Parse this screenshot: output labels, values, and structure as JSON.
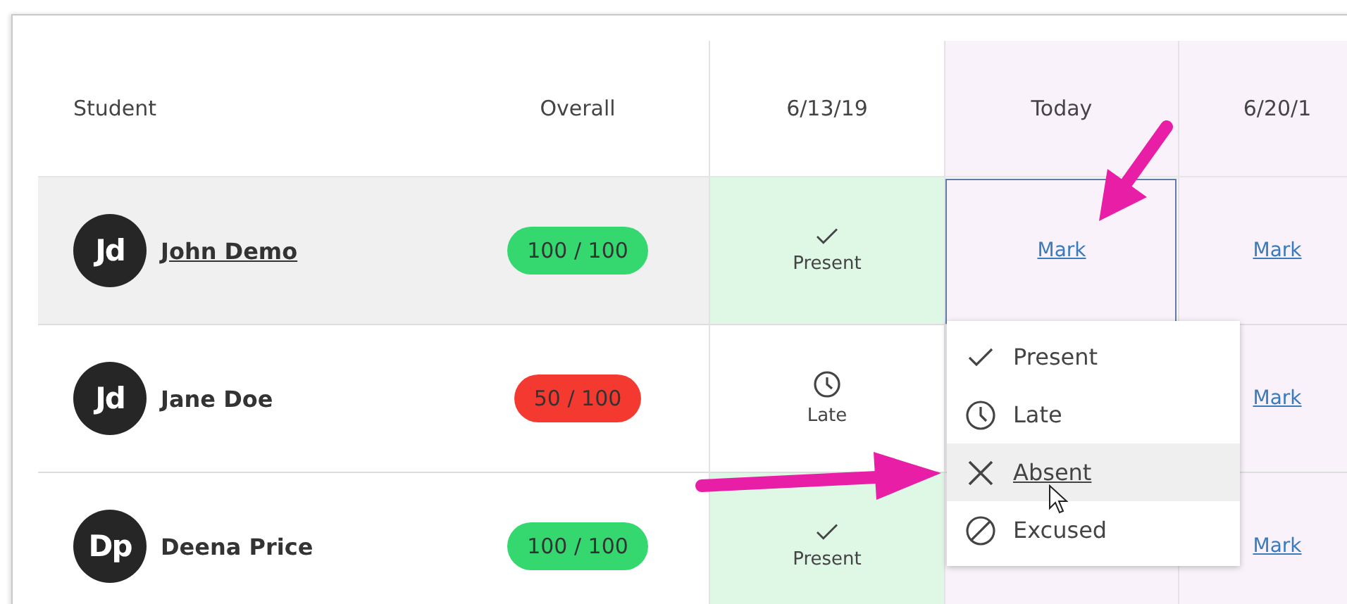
{
  "columns": [
    {
      "label": "Student",
      "today": false
    },
    {
      "label": "Overall",
      "today": false
    },
    {
      "label": "6/13/19",
      "today": false
    },
    {
      "label": "Today",
      "today": true
    },
    {
      "label": "6/20/1",
      "today": true
    }
  ],
  "rows": [
    {
      "initials": "Jd",
      "name": "John Demo",
      "link": true,
      "selected": true,
      "score": "100 / 100",
      "color": "#34d86e",
      "cells": [
        {
          "kind": "present",
          "label": "Present"
        },
        {
          "kind": "mark",
          "label": "Mark",
          "focused": true
        },
        {
          "kind": "mark",
          "label": "Mark",
          "focused": false
        }
      ]
    },
    {
      "initials": "Jd",
      "name": "Jane Doe",
      "link": false,
      "selected": false,
      "score": "50 / 100",
      "color": "#f43a30",
      "cells": [
        {
          "kind": "late",
          "label": "Late"
        },
        {
          "kind": "covered"
        },
        {
          "kind": "mark",
          "label": "Mark",
          "focused": false
        }
      ]
    },
    {
      "initials": "Dp",
      "name": "Deena Price",
      "link": false,
      "selected": false,
      "score": "100 / 100",
      "color": "#34d86e",
      "cells": [
        {
          "kind": "present",
          "label": "Present"
        },
        {
          "kind": "covered"
        },
        {
          "kind": "mark",
          "label": "Mark",
          "focused": false
        }
      ]
    }
  ],
  "menu": {
    "items": [
      {
        "kind": "present",
        "label": "Present",
        "selected": false
      },
      {
        "kind": "late",
        "label": "Late",
        "selected": false
      },
      {
        "kind": "absent",
        "label": "Absent",
        "selected": true
      },
      {
        "kind": "excused",
        "label": "Excused",
        "selected": false
      }
    ]
  }
}
